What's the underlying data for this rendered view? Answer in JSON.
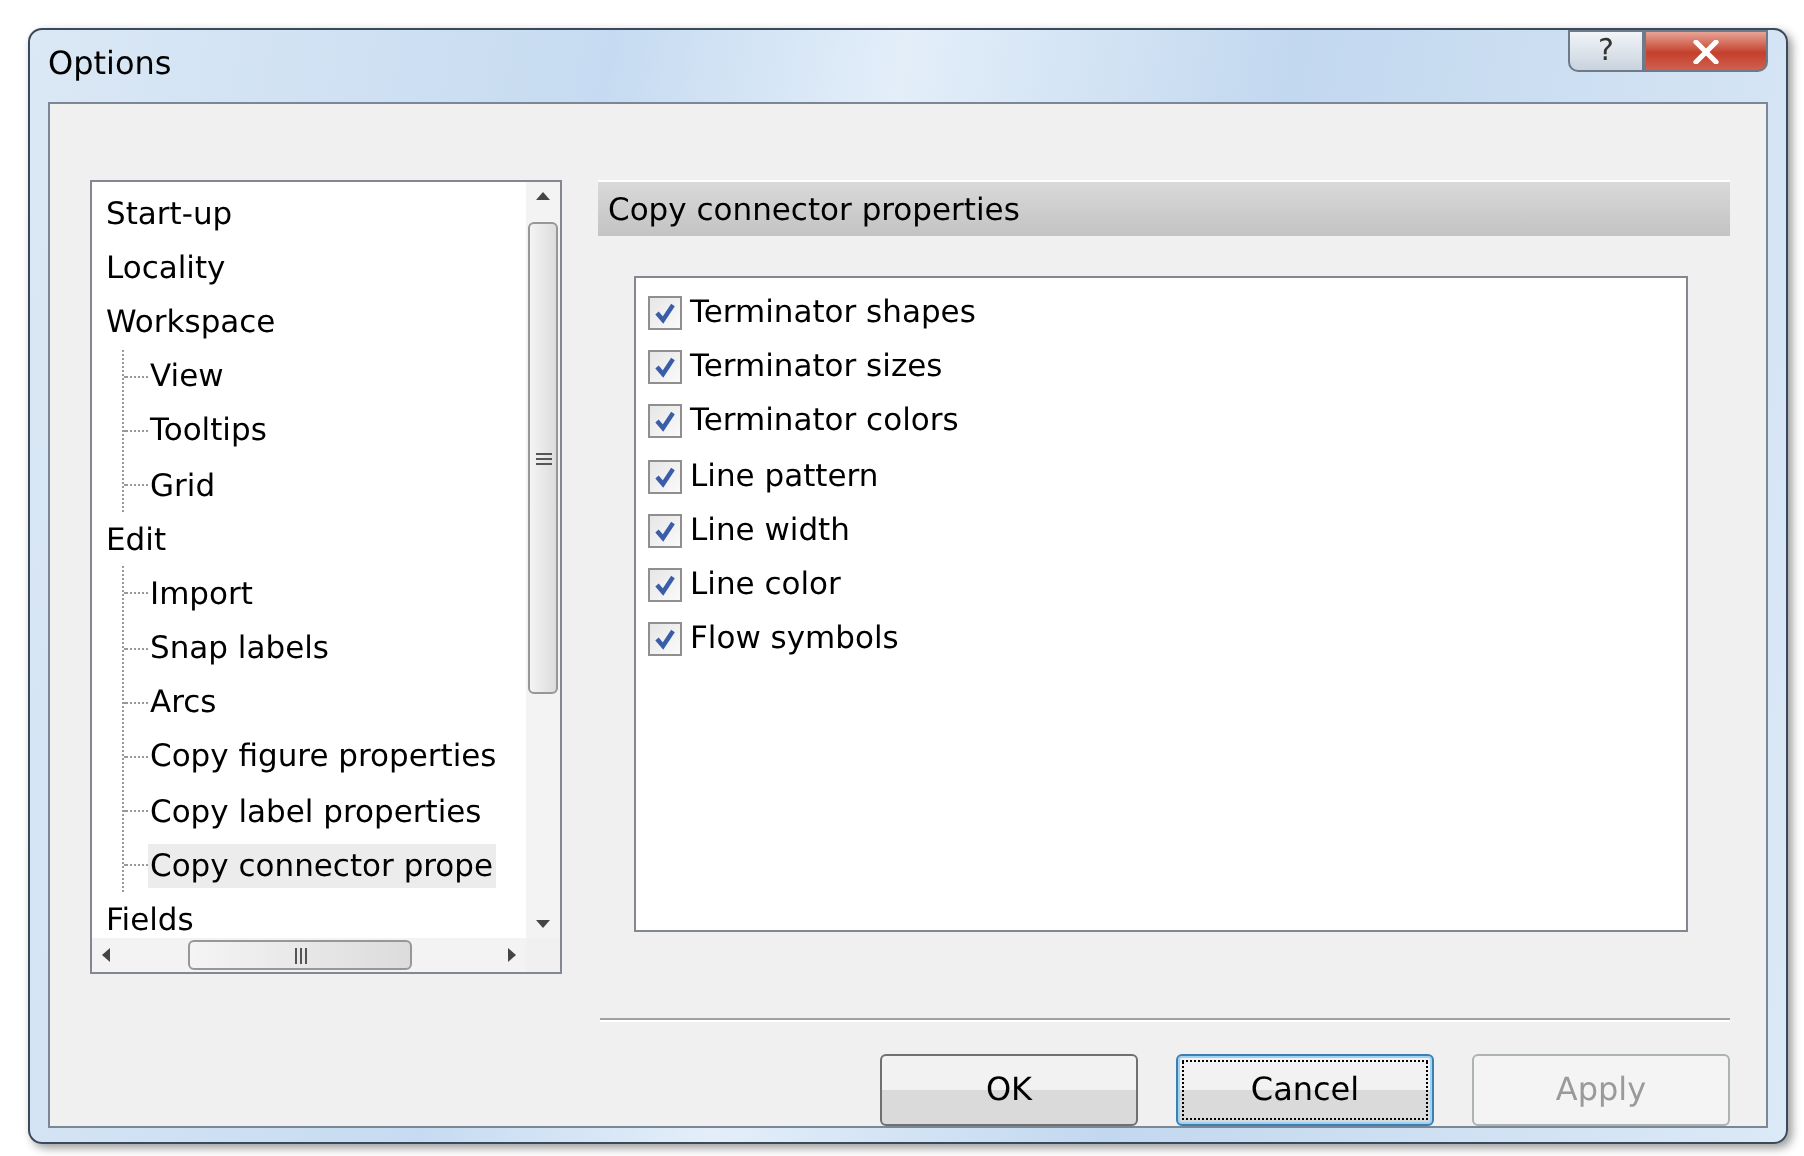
{
  "window": {
    "title": "Options",
    "help_label": "?"
  },
  "tree": {
    "items": [
      {
        "label": "Start-up",
        "selected": false
      },
      {
        "label": "Locality",
        "selected": false
      },
      {
        "label": "Workspace",
        "selected": false,
        "children": [
          {
            "label": "View",
            "selected": false
          },
          {
            "label": "Tooltips",
            "selected": false
          },
          {
            "label": "Grid",
            "selected": false
          }
        ]
      },
      {
        "label": "Edit",
        "selected": false,
        "children": [
          {
            "label": "Import",
            "selected": false
          },
          {
            "label": "Snap labels",
            "selected": false
          },
          {
            "label": "Arcs",
            "selected": false
          },
          {
            "label": "Copy figure properties",
            "selected": false
          },
          {
            "label": "Copy label properties",
            "selected": false
          },
          {
            "label": "Copy connector prope",
            "selected": true
          }
        ]
      },
      {
        "label": "Fields",
        "selected": false
      }
    ]
  },
  "panel": {
    "title": "Copy connector properties",
    "options": [
      {
        "label": "Terminator shapes",
        "checked": true
      },
      {
        "label": "Terminator sizes",
        "checked": true
      },
      {
        "label": "Terminator colors",
        "checked": true
      },
      {
        "label": "Line pattern",
        "checked": true
      },
      {
        "label": "Line width",
        "checked": true
      },
      {
        "label": "Line color",
        "checked": true
      },
      {
        "label": "Flow symbols",
        "checked": true
      }
    ]
  },
  "buttons": [
    {
      "label": "OK",
      "disabled": false,
      "focused": false
    },
    {
      "label": "Cancel",
      "disabled": false,
      "focused": true
    },
    {
      "label": "Apply",
      "disabled": true,
      "focused": false
    }
  ]
}
